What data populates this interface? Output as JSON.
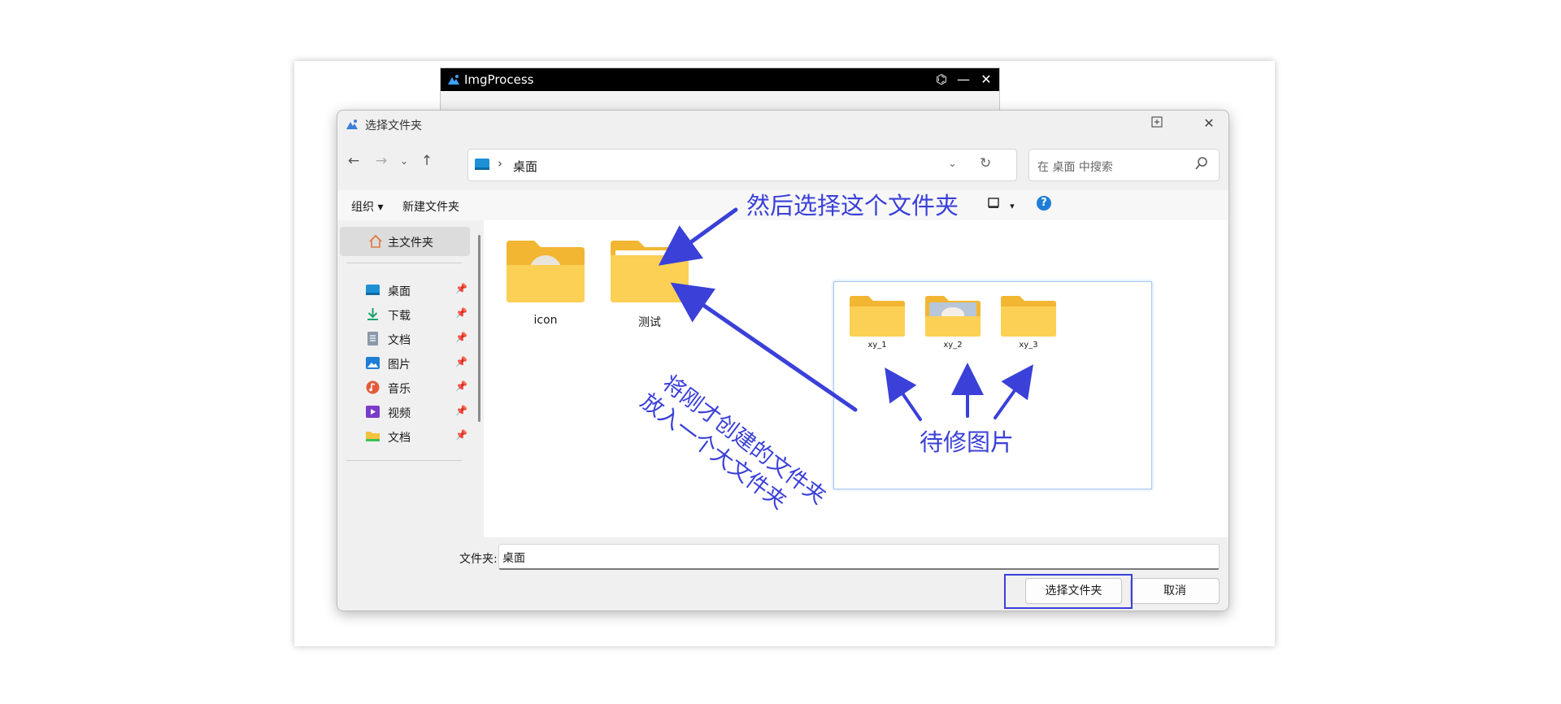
{
  "background_app": {
    "title": "ImgProcess",
    "controls": {
      "github": "⌬",
      "minimize": "—",
      "close": "✕"
    }
  },
  "dialog": {
    "title": "选择文件夹",
    "address": {
      "separator": "›",
      "path": "桌面"
    },
    "search": {
      "placeholder": "在 桌面 中搜索"
    },
    "toolbar": {
      "organize": "组织",
      "new_folder": "新建文件夹"
    },
    "sidebar": {
      "home": "主文件夹",
      "items": [
        {
          "label": "桌面",
          "icon": "desktop-icon",
          "color": "#1e90d6"
        },
        {
          "label": "下载",
          "icon": "download-icon",
          "color": "#1aa36d"
        },
        {
          "label": "文档",
          "icon": "document-icon",
          "color": "#6b7a8c"
        },
        {
          "label": "图片",
          "icon": "picture-icon",
          "color": "#1e7ed6"
        },
        {
          "label": "音乐",
          "icon": "music-icon",
          "color": "#e25a3c"
        },
        {
          "label": "视频",
          "icon": "video-icon",
          "color": "#7a3cc8"
        },
        {
          "label": "文档",
          "icon": "folder-icon",
          "color": "#f2c33d"
        }
      ]
    },
    "folders": [
      {
        "label": "icon"
      },
      {
        "label": "测试"
      }
    ],
    "footer": {
      "folder_label": "文件夹:",
      "folder_value": "桌面",
      "select_button": "选择文件夹",
      "cancel_button": "取消"
    }
  },
  "annotations": {
    "top_note": "然后选择这个文件夹",
    "diagonal_note_line1": "将刚才创建的文件夹",
    "diagonal_note_line2": "放入一个大文件夹",
    "inset_caption": "待修图片",
    "inset_folders": [
      "xy_1",
      "xy_2",
      "xy_3"
    ]
  },
  "colors": {
    "accent": "#3a40d8",
    "folder": "#f6c343"
  }
}
